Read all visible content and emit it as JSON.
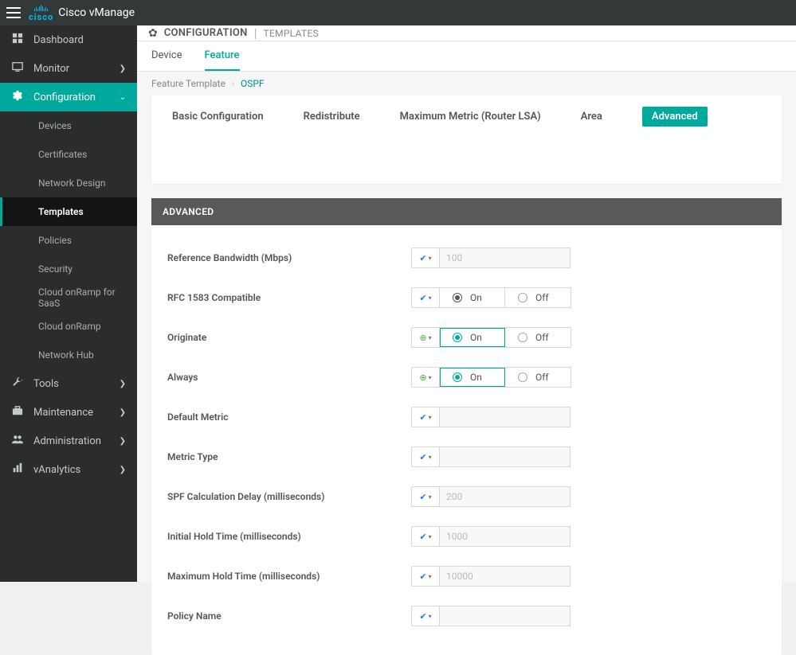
{
  "header": {
    "product": "Cisco vManage",
    "logo_text": "cisco"
  },
  "sidebar": {
    "items": [
      {
        "label": "Dashboard",
        "icon": "dashboard-icon"
      },
      {
        "label": "Monitor",
        "icon": "monitor-icon",
        "chevron": true
      },
      {
        "label": "Configuration",
        "icon": "gear-icon",
        "active": true,
        "expanded": true
      },
      {
        "label": "Tools",
        "icon": "wrench-icon",
        "chevron": true
      },
      {
        "label": "Maintenance",
        "icon": "briefcase-icon",
        "chevron": true
      },
      {
        "label": "Administration",
        "icon": "people-icon",
        "chevron": true
      },
      {
        "label": "vAnalytics",
        "icon": "analytics-icon",
        "chevron": true
      }
    ],
    "config_sub": [
      "Devices",
      "Certificates",
      "Network Design",
      "Templates",
      "Policies",
      "Security",
      "Cloud onRamp for SaaS",
      "Cloud onRamp",
      "Network Hub"
    ],
    "config_sub_active": "Templates"
  },
  "page": {
    "title": "CONFIGURATION",
    "subtitle": "TEMPLATES",
    "tabs": [
      "Device",
      "Feature"
    ],
    "active_tab": "Feature",
    "breadcrumb": {
      "parent": "Feature Template",
      "current": "OSPF"
    },
    "section_tabs": [
      "Basic Configuration",
      "Redistribute",
      "Maximum Metric (Router LSA)",
      "Area",
      "Advanced"
    ],
    "active_section": "Advanced",
    "section_title": "ADVANCED"
  },
  "toggle": {
    "on": "On",
    "off": "Off"
  },
  "form": {
    "reference_bandwidth": {
      "label": "Reference Bandwidth (Mbps)",
      "scope": "default",
      "placeholder": "100",
      "value": ""
    },
    "rfc1583": {
      "label": "RFC 1583 Compatible",
      "scope": "default",
      "value": "On"
    },
    "originate": {
      "label": "Originate",
      "scope": "global",
      "value": "On"
    },
    "always": {
      "label": "Always",
      "scope": "global",
      "value": "On"
    },
    "default_metric": {
      "label": "Default Metric",
      "scope": "default",
      "value": ""
    },
    "metric_type": {
      "label": "Metric Type",
      "scope": "default",
      "value": ""
    },
    "spf_delay": {
      "label": "SPF Calculation Delay (milliseconds)",
      "scope": "default",
      "placeholder": "200",
      "value": ""
    },
    "initial_hold": {
      "label": "Initial Hold Time (milliseconds)",
      "scope": "default",
      "placeholder": "1000",
      "value": ""
    },
    "max_hold": {
      "label": "Maximum Hold Time (milliseconds)",
      "scope": "default",
      "placeholder": "10000",
      "value": ""
    },
    "policy_name": {
      "label": "Policy Name",
      "scope": "default",
      "value": ""
    }
  }
}
